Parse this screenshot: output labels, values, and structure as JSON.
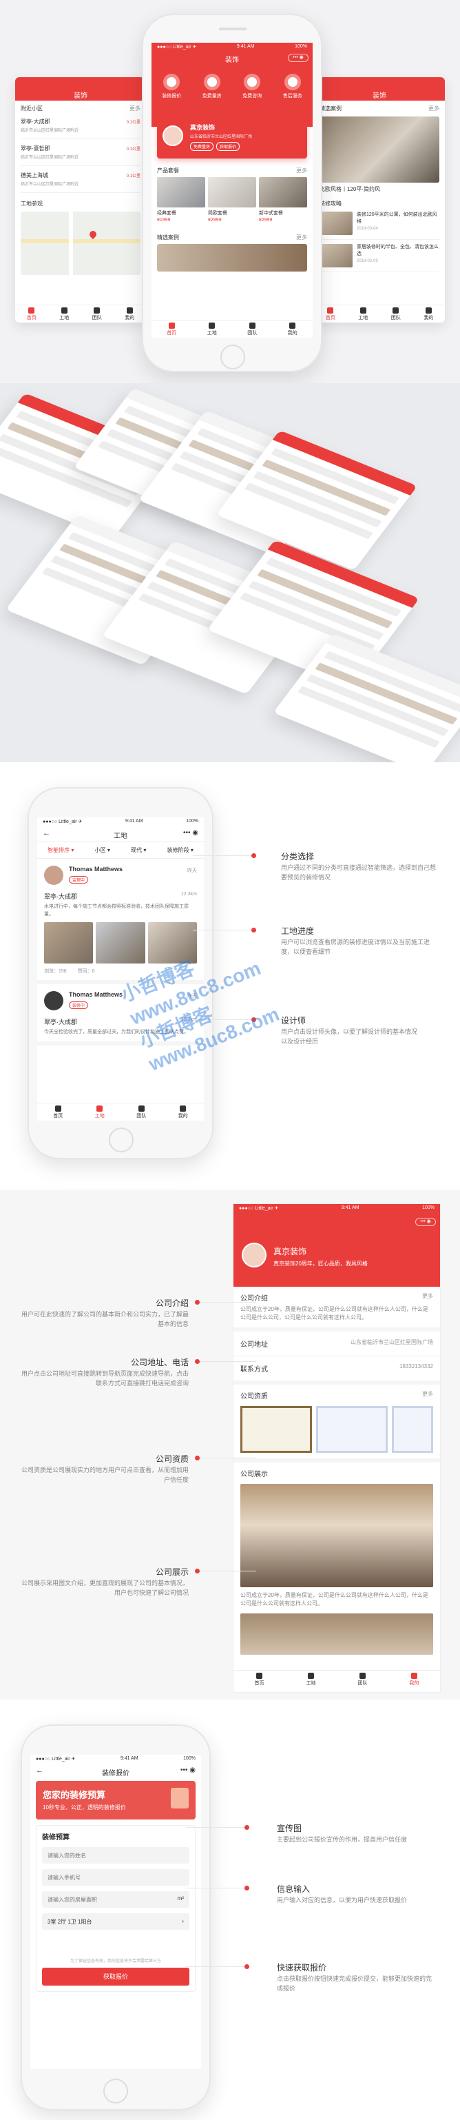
{
  "colors": {
    "accent": "#e93d3b",
    "bg": "#f2f2f4"
  },
  "s1": {
    "status_carrier": "●●●○○ Little_air ✈",
    "status_time": "9:41 AM",
    "status_battery": "100%",
    "app_title": "装饰",
    "capsule": "••• ◉",
    "quick": [
      "装修报价",
      "免费量房",
      "免费咨询",
      "售后服务"
    ],
    "company_name": "真京装饰",
    "company_addr": "山东省临沂市兰山区红星国际广场",
    "company_btn1": "免费量房",
    "company_btn2": "获取报价",
    "products_title": "产品套餐",
    "more": "更多",
    "products": [
      {
        "name": "经典套餐",
        "price": "¥1999"
      },
      {
        "name": "简欧套餐",
        "price": "¥2999"
      },
      {
        "name": "新中式套餐",
        "price": "¥2999"
      }
    ],
    "cases_title": "精选案例",
    "left_title": "装饰",
    "left_section": "附近小区",
    "left_items": [
      {
        "name": "翠亭·大成郡",
        "sub": "临沂市兰山区红星国际广场附近",
        "dist": "0.1公里"
      },
      {
        "name": "翠亭·豪哲郡",
        "sub": "临沂市兰山区红星国际广场附近",
        "dist": "0.1公里"
      },
      {
        "name": "德美上海城",
        "sub": "临沂市兰山区红星国际广场附近",
        "dist": "0.1公里"
      }
    ],
    "left_map_title": "工地参观",
    "right_title": "装饰",
    "right_case_title": "精选案例",
    "right_case_caption": "北欧风格丨120平·简约风",
    "right_news_title": "装修攻略",
    "right_news": [
      {
        "title": "装修120平米的公寓，如何装出北欧风格",
        "date": "2018-03-04"
      },
      {
        "title": "家居装修时的半包、全包、清包该怎么选",
        "date": "2018-03-09"
      }
    ],
    "tabs": [
      "首页",
      "工地",
      "团队",
      "我的"
    ]
  },
  "s3": {
    "status_carrier": "●●●○○ Little_air ✈",
    "status_time": "9:41 AM",
    "status_battery": "100%",
    "title": "工地",
    "filters": [
      "智能排序",
      "小区",
      "现代",
      "装修阶段"
    ],
    "cards": [
      {
        "user": "Thomas Matthews",
        "badge": "监理中",
        "time": "昨天",
        "project": "翠亭·大成郡",
        "dist": "12.3km",
        "desc": "水电进行中，每个施工节点都会按照标准验收，技术团队保障施工质量。",
        "views": "浏览：158",
        "likes": "赞同：6"
      },
      {
        "user": "Thomas Matthews",
        "badge": "装修中",
        "time": "昨天",
        "project": "翠亭·大成郡",
        "dist": "12.3km",
        "desc": "今天全检验收完了，质量全部过关，为我们的设计和施工团队点赞。",
        "views": "",
        "likes": ""
      }
    ],
    "tabs": [
      "首页",
      "工地",
      "团队",
      "我的"
    ],
    "ann": [
      {
        "t": "分类选择",
        "d": "用户通过不同的分类可直接通过智能筛选，选择到自己想要预览的装修情况"
      },
      {
        "t": "工地进度",
        "d": "用户可以浏览查看房源的装修进度详情以及当前施工进度，以便查看细节"
      },
      {
        "t": "设计师",
        "d": "用户点击设计师头像，以便了解设计师的基本情况以及设计经历"
      }
    ]
  },
  "s4": {
    "status_carrier": "●●●○○ Little_air ✈",
    "status_time": "9:41 AM",
    "status_battery": "100%",
    "company": "真京装饰",
    "slogan": "真京装饰20周年，匠心品质，我具风格",
    "intro_title": "公司介绍",
    "intro_more": "更多",
    "intro_text": "公司成立于20年，质量有保证，公司是什么公司就有这样什么人公司，什么是公司是什么公司，公司是什么公司就有这样人公司。",
    "addr_label": "公司地址",
    "addr_value": "山东省临沂市兰山区红星国际广场",
    "contact_label": "联系方式",
    "contact_value": "18332134332",
    "cert_title": "公司资质",
    "show_title": "公司展示",
    "show_text": "公司成立于20年，质量有保证，公司是什么公司就有这样什么人公司，什么是公司是什么公司就有这样人公司。",
    "tabs": [
      "首页",
      "工地",
      "团队",
      "我的"
    ],
    "ann": [
      {
        "t": "公司介绍",
        "d": "用户可在此快速的了解公司的基本简介和公司实力，已了解最基本的信息"
      },
      {
        "t": "公司地址、电话",
        "d": "用户点击公司地址可直接跳转到导航页面完成快速导航，点击联系方式可直接跳打电话完成咨询"
      },
      {
        "t": "公司资质",
        "d": "公司资质是公司展现实力的地方用户可点击查看，从而增加用户信任度"
      },
      {
        "t": "公司展示",
        "d": "公司展示采用图文介绍，更加直观的展现了公司的基本情况，用户也可快速了解公司情况"
      }
    ]
  },
  "s5": {
    "status_carrier": "●●●○○ Little_air ✈",
    "status_time": "9:41 AM",
    "status_battery": "100%",
    "title": "装修报价",
    "banner_title": "您家的装修预算",
    "banner_sub": "10秒专业、公正，透明的装修报价",
    "form_title": "装修预算",
    "ph_name": "请输入您的姓名",
    "ph_phone": "请输入手机号",
    "ph_area": "请输入您的房屋面积",
    "area_unit": "m²",
    "layout_value": "3室 2厅 1卫 1阳台",
    "note": "为了保证信息有效，您的信息将不会泄露给第三方",
    "submit": "获取报价",
    "ann": [
      {
        "t": "宣传图",
        "d": "主要起到公司报价宣传的作用，提高用户信任度"
      },
      {
        "t": "信息输入",
        "d": "用户输入对应的信息，以便为用户快速获取报价"
      },
      {
        "t": "快速获取报价",
        "d": "点击获取报价按钮快速完成报价提交，能够更加快速的完成报价"
      }
    ]
  },
  "watermark": [
    "小哲博客",
    "www.8uc8.com"
  ]
}
